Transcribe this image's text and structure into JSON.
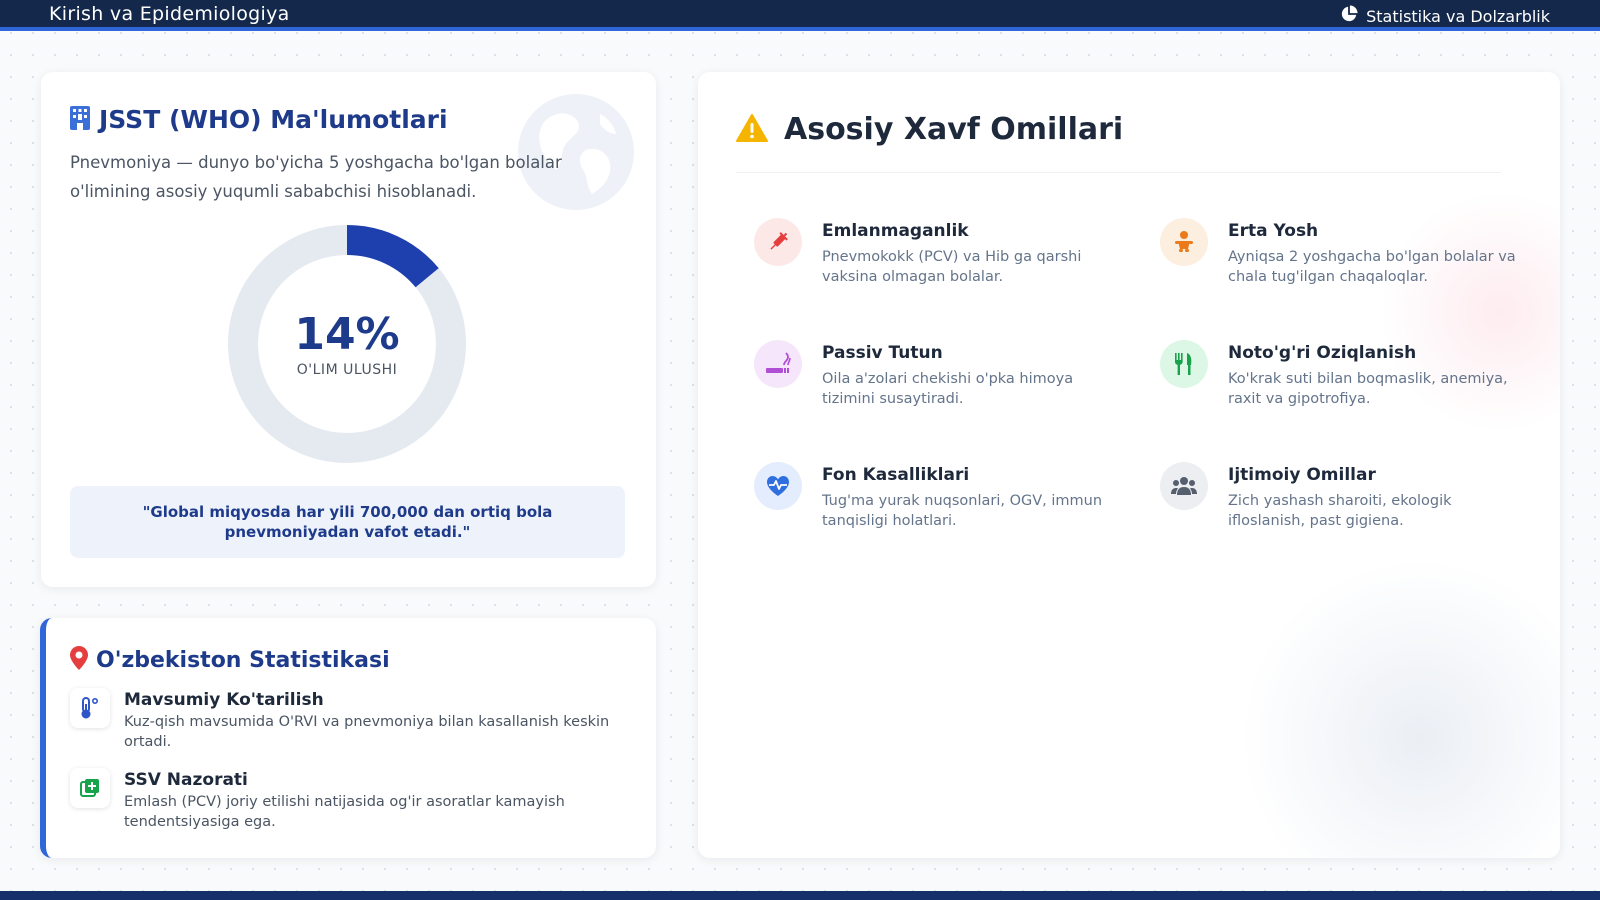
{
  "header": {
    "title": "Kirish va Epidemiologiya",
    "right_label": "Statistika va Dolzarblik",
    "right_icon": "pie-chart-icon"
  },
  "colors": {
    "navy": "#13284a",
    "accent_blue": "#2f66d9",
    "title_blue": "#1e3a8a",
    "donut_fill": "#1e40af",
    "donut_track": "#e5e9f0"
  },
  "who": {
    "icon": "hospital-icon",
    "title": "JSST (WHO) Ma'lumotlari",
    "description": "Pnevmoniya — dunyo bo'yicha 5 yoshgacha bo'lgan bolalar o'limining asosiy yuqumli sababchisi hisoblanadi.",
    "donut": {
      "value_text": "14%",
      "fraction": 0.14,
      "label": "O'LIM ULUSHI"
    },
    "quote": "\"Global miqyosda har yili 700,000 dan ortiq bola pnevmoniyadan vafot etadi.\""
  },
  "uzbekistan": {
    "icon": "map-pin-icon",
    "title": "O'zbekiston Statistikasi",
    "items": [
      {
        "icon": "thermometer-icon",
        "title": "Mavsumiy Ko'tarilish",
        "desc": "Kuz-qish mavsumida O'RVI va pnevmoniya bilan kasallanish keskin ortadi."
      },
      {
        "icon": "medical-plus-icon",
        "title": "SSV Nazorati",
        "desc": "Emlash (PCV) joriy etilishi natijasida og'ir asoratlar kamayish tendentsiyasiga ega."
      }
    ]
  },
  "risk": {
    "icon": "warning-icon",
    "title": "Asosiy Xavf Omillari",
    "items": [
      {
        "icon": "syringe-icon",
        "color": "#e53e3e",
        "bg": "#fde8e8",
        "title": "Emlanmaganlik",
        "desc": "Pnevmokokk (PCV) va Hib ga qarshi vaksina olmagan bolalar."
      },
      {
        "icon": "baby-icon",
        "color": "#ea7a1a",
        "bg": "#fdefdf",
        "title": "Erta Yosh",
        "desc": "Ayniqsa 2 yoshgacha bo'lgan bolalar va chala tug'ilgan chaqaloqlar."
      },
      {
        "icon": "smoking-icon",
        "color": "#b04fd6",
        "bg": "#f5e6fb",
        "title": "Passiv Tutun",
        "desc": "Oila a'zolari chekishi o'pka himoya tizimini susaytiradi."
      },
      {
        "icon": "utensils-icon",
        "color": "#16a34a",
        "bg": "#dcf7e6",
        "title": "Noto'g'ri Oziqlanish",
        "desc": "Ko'krak suti bilan boqmaslik, anemiya, raxit va gipotrofiya."
      },
      {
        "icon": "heart-pulse-icon",
        "color": "#2f6fe0",
        "bg": "#e3edfd",
        "title": "Fon Kasalliklari",
        "desc": "Tug'ma yurak nuqsonlari, OGV, immun tanqisligi holatlari."
      },
      {
        "icon": "users-icon",
        "color": "#555f6e",
        "bg": "#eceef1",
        "title": "Ijtimoiy Omillar",
        "desc": "Zich yashash sharoiti, ekologik ifloslanish, past gigiena."
      }
    ]
  }
}
